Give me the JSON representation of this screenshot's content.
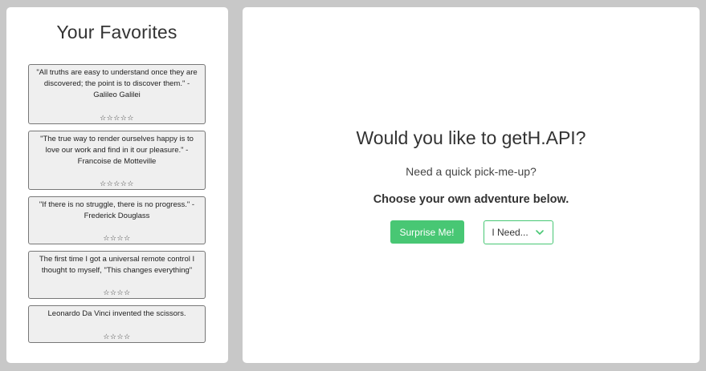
{
  "favorites": {
    "title": "Your Favorites",
    "items": [
      {
        "text": "\"All truths are easy to understand once they are discovered; the point is to discover them.\" - Galileo Galilei",
        "stars": "☆☆☆☆☆"
      },
      {
        "text": "\"The true way to render ourselves happy is to love our work and find in it our pleasure.\" - Francoise de Motteville",
        "stars": "☆☆☆☆☆"
      },
      {
        "text": "\"If there is no struggle, there is no progress.\" - Frederick Douglass",
        "stars": "☆☆☆☆"
      },
      {
        "text": "The first time I got a universal remote control I thought to myself, \"This changes everything\"",
        "stars": "☆☆☆☆"
      },
      {
        "text": "Leonardo Da Vinci invented the scissors.",
        "stars": "☆☆☆☆"
      }
    ]
  },
  "main": {
    "heading": "Would you like to getH.API?",
    "subheading": "Need a quick pick-me-up?",
    "cta": "Choose your own adventure below.",
    "surprise_label": "Surprise Me!",
    "need_label": "I Need..."
  },
  "colors": {
    "accent": "#48c774",
    "background": "#c8c8c8",
    "card": "#efefef"
  }
}
